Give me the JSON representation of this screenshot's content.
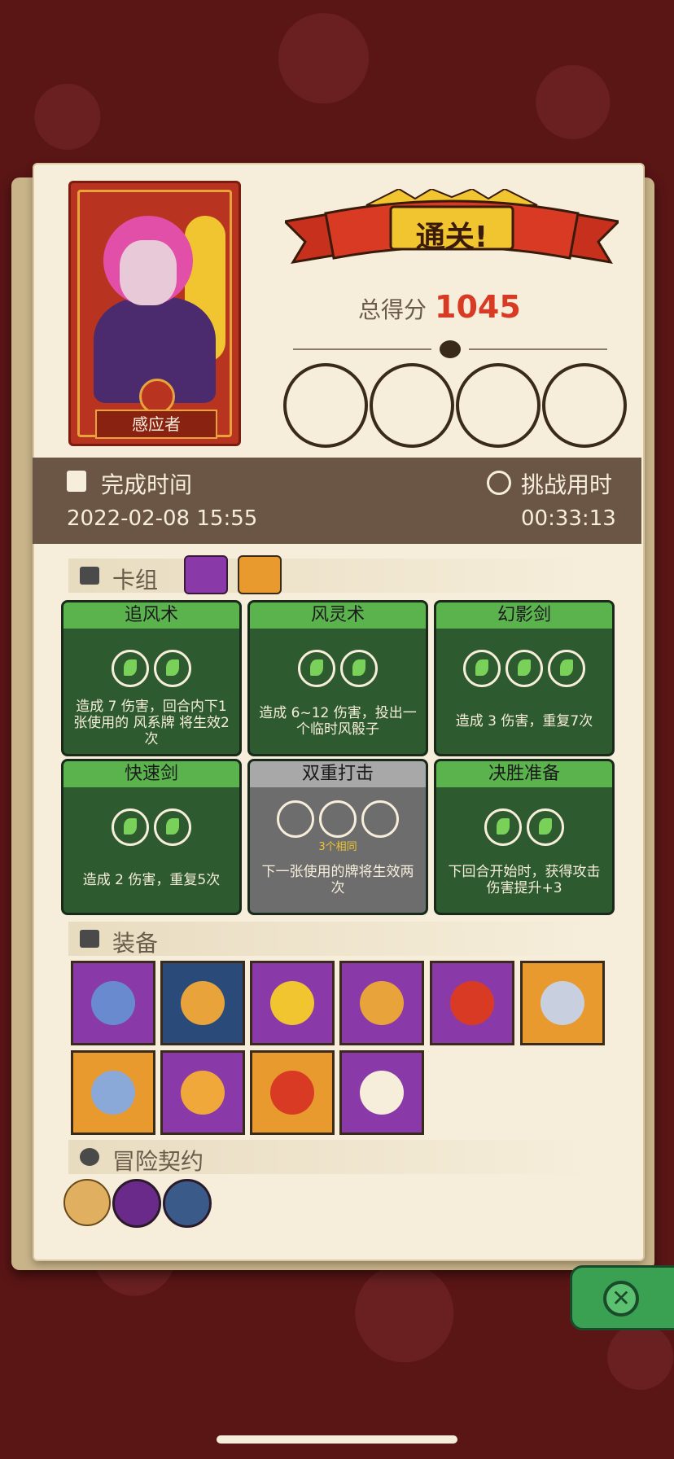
{
  "character": {
    "name": "感应者"
  },
  "result": {
    "banner": "通关!",
    "score_label": "总得分",
    "score": "1045"
  },
  "bosses": [
    {
      "icon": "cyclops-boss-icon",
      "color": "#c0803a"
    },
    {
      "icon": "dragon-boss-icon",
      "color": "#d8d26a"
    },
    {
      "icon": "shark-boss-icon",
      "color": "#6a8ab0"
    },
    {
      "icon": "vampire-boss-icon",
      "color": "#c8302a"
    }
  ],
  "stats": {
    "finish_time_label": "完成时间",
    "finish_time_value": "2022-02-08 15:55",
    "challenge_time_label": "挑战用时",
    "challenge_time_value": "00:33:13"
  },
  "deck": {
    "title": "卡组",
    "cards": [
      {
        "title": "追风术",
        "gems": [
          "green",
          "green"
        ],
        "desc": "造成 7 伤害，回合内下1张使用的 风系牌 将生效2次",
        "sub": ""
      },
      {
        "title": "风灵术",
        "gems": [
          "green",
          "green"
        ],
        "desc": "造成 6~12 伤害，投出一个临时风骰子",
        "sub": ""
      },
      {
        "title": "幻影剑",
        "gems": [
          "green",
          "green",
          "green"
        ],
        "desc": "造成 3 伤害，重复7次",
        "sub": ""
      },
      {
        "title": "快速剑",
        "gems": [
          "green",
          "green"
        ],
        "desc": "造成 2 伤害，重复5次",
        "sub": ""
      },
      {
        "title": "双重打击",
        "gems": [
          "empty",
          "empty",
          "empty"
        ],
        "desc": "下一张使用的牌将生效两次",
        "sub": "3个相同"
      },
      {
        "title": "决胜准备",
        "gems": [
          "green",
          "green"
        ],
        "desc": "下回合开始时，获得攻击伤害提升+3",
        "sub": ""
      }
    ]
  },
  "equipment": {
    "title": "装备",
    "items": [
      {
        "icon": "crescent-blade-icon",
        "bg": "purple"
      },
      {
        "icon": "fire-mirror-icon",
        "bg": "navy"
      },
      {
        "icon": "heart-amulet-icon",
        "bg": "purple"
      },
      {
        "icon": "gem-ring-icon",
        "bg": "purple"
      },
      {
        "icon": "spiked-bracelet-icon",
        "bg": "purple"
      },
      {
        "icon": "horn-icon",
        "bg": "orange"
      },
      {
        "icon": "battle-axe-icon",
        "bg": "orange"
      },
      {
        "icon": "crown-icon",
        "bg": "purple"
      },
      {
        "icon": "red-ring-icon",
        "bg": "orange"
      },
      {
        "icon": "fangs-icon",
        "bg": "purple"
      }
    ]
  },
  "contracts": {
    "title": "冒险契约",
    "items": [
      {
        "icon": "scroll-icon",
        "color": "#e0b060"
      },
      {
        "icon": "eye-seal-icon",
        "color": "#6a2a8a"
      },
      {
        "icon": "potion-icon",
        "color": "#3a5a8a"
      }
    ]
  },
  "colors": {
    "accent_red": "#d83a24",
    "card_green": "#2d5a2e",
    "title_green": "#5bb34e"
  }
}
